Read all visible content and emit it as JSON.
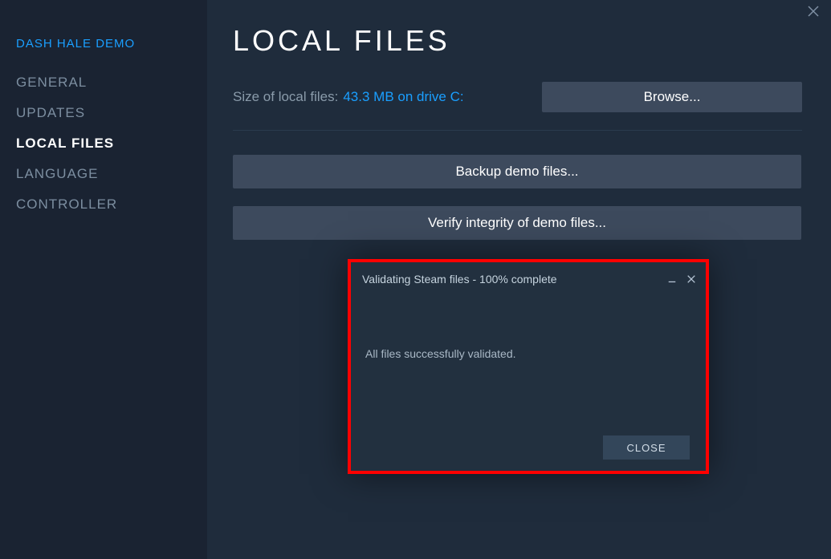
{
  "sidebar": {
    "game_title": "DASH HALE DEMO",
    "items": [
      {
        "label": "GENERAL"
      },
      {
        "label": "UPDATES"
      },
      {
        "label": "LOCAL FILES"
      },
      {
        "label": "LANGUAGE"
      },
      {
        "label": "CONTROLLER"
      }
    ],
    "active_index": 2
  },
  "main": {
    "page_title": "LOCAL FILES",
    "size_label": "Size of local files:",
    "size_value": "43.3 MB on drive C:",
    "browse_label": "Browse...",
    "backup_label": "Backup demo files...",
    "verify_label": "Verify integrity of demo files..."
  },
  "dialog": {
    "title": "Validating Steam files - 100% complete",
    "message": "All files successfully validated.",
    "close_label": "CLOSE"
  }
}
